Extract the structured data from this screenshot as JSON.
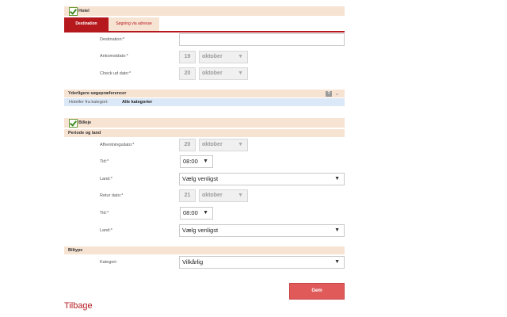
{
  "hotel": {
    "title": "Hotel",
    "tabs": [
      {
        "label": "Destination"
      },
      {
        "label": "Søgning via adresse"
      }
    ],
    "destination_label": "Destination:*",
    "arrival_label": "Ankomstdato:*",
    "arrival_day": "19",
    "arrival_month": "oktober",
    "checkout_label": "Check ud dato:*",
    "checkout_day": "20",
    "checkout_month": "oktober"
  },
  "preferences": {
    "title": "Yderligere søgepræferencer",
    "category_label": "Hoteller fra kategori:",
    "category_value": "Alle kategorier"
  },
  "car": {
    "title": "Billeje",
    "period_title": "Periode og land",
    "pickup_label": "Afhentningsdato:*",
    "pickup_day": "20",
    "pickup_month": "oktober",
    "time_label": "Tid:*",
    "pickup_time": "08:00",
    "country_label": "Land:*",
    "country_value": "Vælg venligst",
    "return_label": "Retur dato:*",
    "return_day": "21",
    "return_month": "oktober",
    "return_time_label": "Tid:*",
    "return_time": "08:00",
    "return_country_label": "Land:*",
    "return_country_value": "Vælg venligst"
  },
  "cartype": {
    "title": "Biltype",
    "category_label": "Kategori:",
    "category_value": "Vilkårlig"
  },
  "search_button": "Gem",
  "back_link": "Tilbage",
  "colors": {
    "accent": "#b5191e",
    "band": "#f7e3d2",
    "button": "#e05a5a",
    "category_bar": "#dbe8f7"
  }
}
